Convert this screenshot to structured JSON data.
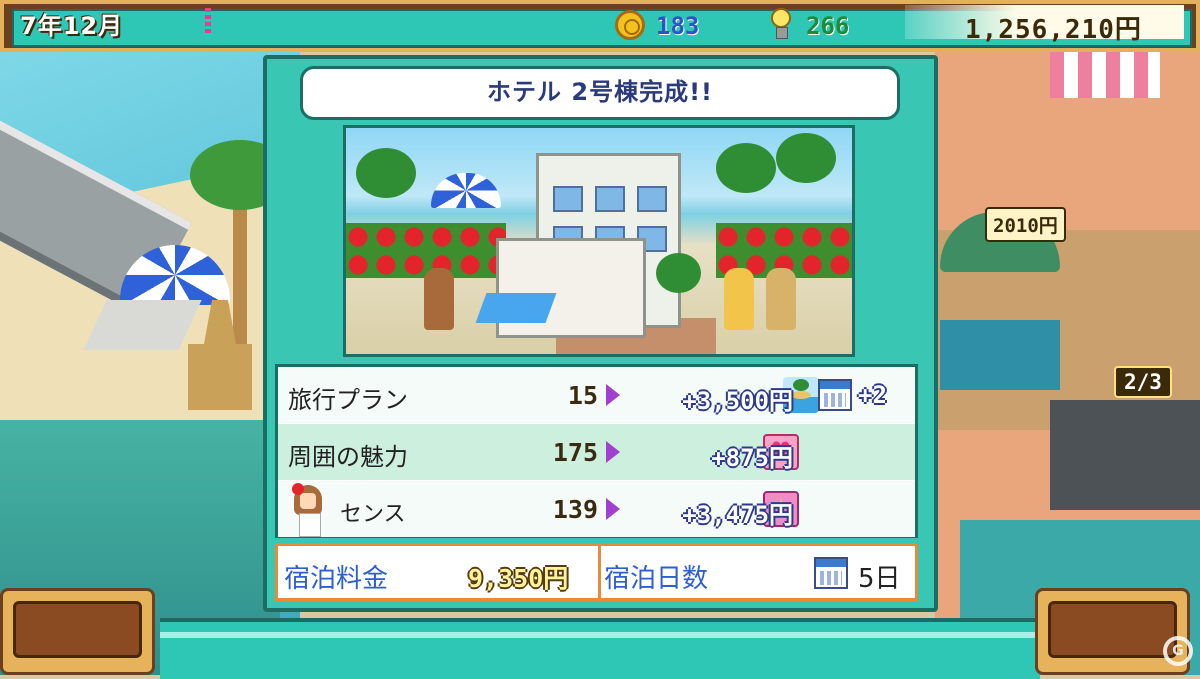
{
  "hud": {
    "date": "7年12月",
    "medals": "183",
    "research": "266",
    "money": "1,256,210円"
  },
  "town": {
    "price_popup": "2010円",
    "counter": "2/3"
  },
  "dialog": {
    "title": "ホテル 2号棟完成!!",
    "rows": [
      {
        "label": "旅行プラン",
        "icon": "island-icon",
        "value": "15",
        "bonus": "+3,500円",
        "extra_icon": "calendar-icon",
        "extra": "+2"
      },
      {
        "label": "周囲の魅力",
        "icon": "heart-icon",
        "value": "175",
        "bonus": "+875円"
      },
      {
        "label": "センス",
        "icon": "sense-icon",
        "value": "139",
        "bonus": "+3,475円"
      }
    ],
    "footer": {
      "price_label": "宿泊料金",
      "price_value": "9,350円",
      "days_label": "宿泊日数",
      "days_value": "5日"
    }
  },
  "colors": {
    "panel": "#39c6b3",
    "panel_border": "#1c6e64",
    "hud_frame": "#e3b15c",
    "bonus_outline": "#2d3a8a",
    "footer_border": "#e88a3a"
  }
}
